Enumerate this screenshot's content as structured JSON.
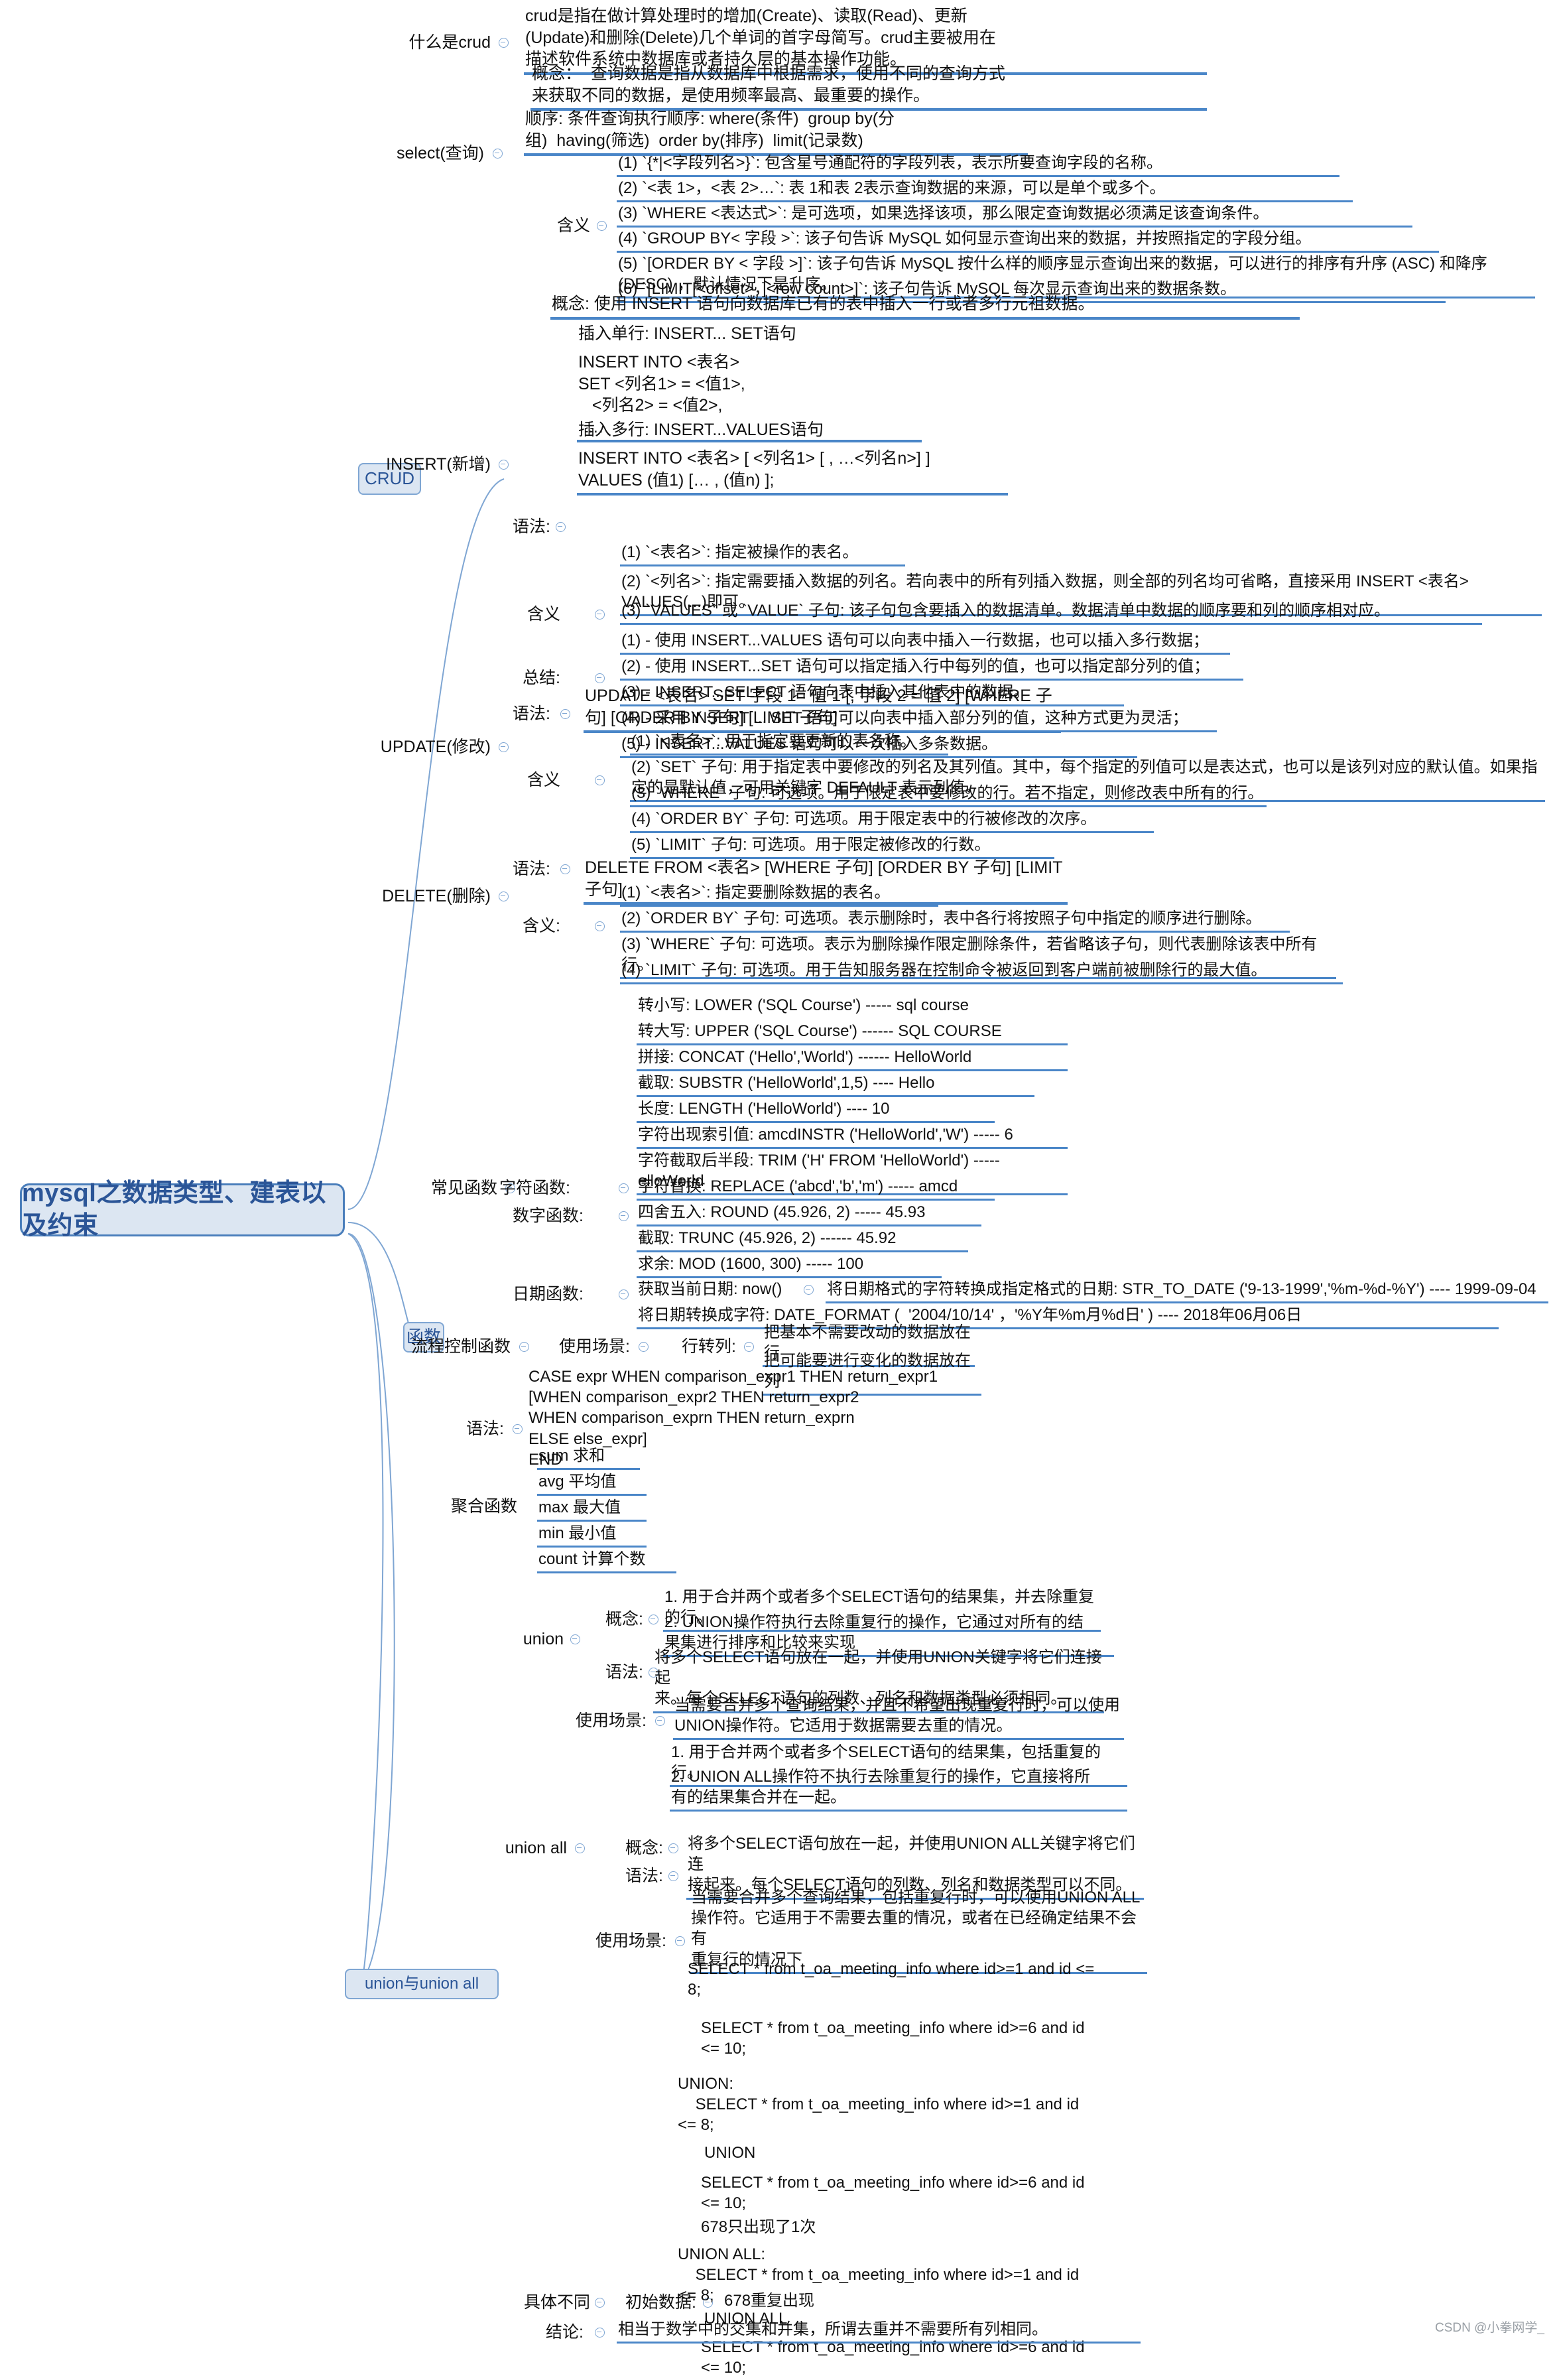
{
  "meta": {
    "root_title": "mysql之数据类型、建表以及约束",
    "watermark": "CSDN @小拳网学_",
    "accent": "#4a86c8",
    "root_fill": "#dce6f2",
    "root_border": "#4a7ebb",
    "root_text": "#2b5597"
  },
  "branches": {
    "crud": "CRUD",
    "func": "函数",
    "union": "union与union all"
  },
  "crud": {
    "what_is_crud": {
      "label": "什么是crud",
      "text": "crud是指在做计算处理时的增加(Create)、读取(Read)、更新\n(Update)和删除(Delete)几个单词的首字母简写。crud主要被用在\n描述软件系统中数据库或者持久层的基本操作功能。"
    },
    "select": {
      "label": "select(查询)",
      "concept": "概念：  查询数据是指从数据库中根据需求，使用不同的查询方式\n来获取不同的数据，是使用频率最高、最重要的操作。",
      "order": "顺序: 条件查询执行顺序: where(条件)  group by(分\n组)  having(筛选)  order by(排序)  limit(记录数)",
      "meaning_label": "含义",
      "meanings": [
        "(1) `{*|<字段列名>}`: 包含星号通配符的字段列表，表示所要查询字段的名称。",
        "(2) `<表 1>，<表 2>…`: 表 1和表 2表示查询数据的来源，可以是单个或多个。",
        "(3) `WHERE <表达式>`: 是可选项，如果选择该项，那么限定查询数据必须满足该查询条件。",
        "(4) `GROUP BY< 字段 >`: 该子句告诉 MySQL 如何显示查询出来的数据，并按照指定的字段分组。",
        "(5) `[ORDER BY < 字段 >]`: 该子句告诉 MySQL 按什么样的顺序显示查询出来的数据，可以进行的排序有升序 (ASC) 和降序 (DESC) ，默认情况下是升序。",
        "(6) `[LIMIT[<offset>，]<row count>]`: 该子句告诉 MySQL 每次显示查询出来的数据条数。"
      ]
    },
    "insert": {
      "label": "INSERT(新增)",
      "concept": "概念: 使用 INSERT 语句向数据库已有的表中插入一行或者多行元祖数据。",
      "syntax_label": "语法:",
      "syntax_single_title": "插入单行: INSERT... SET语句",
      "syntax_single_code": "INSERT INTO <表名>\nSET <列名1> = <值1>,\n   <列名2> = <值2>,\n  …",
      "syntax_multi_title": "插入多行: INSERT...VALUES语句",
      "syntax_multi_code": "INSERT INTO <表名> [ <列名1> [ , …<列名n>] ]\nVALUES (值1) [… , (值n) ];",
      "meaning_label": "含义",
      "meanings": [
        "(1) `<表名>`: 指定被操作的表名。",
        "(2) `<列名>`: 指定需要插入数据的列名。若向表中的所有列插入数据，则全部的列名均可省略，直接采用 INSERT <表名> VALUES(...)即可。",
        "(3) `VALUES` 或 `VALUE` 子句: 该子句包含要插入的数据清单。数据清单中数据的顺序要和列的顺序相对应。"
      ],
      "summary_label": "总结:",
      "summaries": [
        "(1) - 使用 INSERT...VALUES 语句可以向表中插入一行数据，也可以插入多行数据；",
        "(2) - 使用 INSERT...SET 语句可以指定插入行中每列的值，也可以指定部分列的值；",
        "(3) - INSERT...SELECT 语句向表中插入其他表中的数据。",
        "(4) - 采用 INSERT ... SET 语句可以向表中插入部分列的值，这种方式更为灵活；",
        "(5) - INSERT...VALUES 语句可以一次插入多条数据。"
      ]
    },
    "update": {
      "label": "UPDATE(修改)",
      "syntax_label": "语法:",
      "syntax": "UPDATE <表名> SET 字段 1= 值 1 [, 字段 2 = 值 2] [WHERE 子\n句] [ORDER BY 子句] [LIMIT 子句]",
      "meaning_label": "含义",
      "meanings": [
        "(1) `<表名>`: 用于指定要更新的表名称。",
        "(2) `SET` 子句: 用于指定表中要修改的列名及其列值。其中，每个指定的列值可以是表达式，也可以是该列对应的默认值。如果指定的是默认值，可用关键字 DEFAULT 表示列值。",
        "(3) `WHERE` 子句: 可选项。用于限定表中要修改的行。若不指定，则修改表中所有的行。",
        "(4) `ORDER BY` 子句: 可选项。用于限定表中的行被修改的次序。",
        "(5) `LIMIT` 子句: 可选项。用于限定被修改的行数。"
      ]
    },
    "delete": {
      "label": "DELETE(删除)",
      "syntax_label": "语法:",
      "syntax": "DELETE FROM <表名> [WHERE 子句] [ORDER BY 子句] [LIMIT 子句]",
      "meaning_label": "含义:",
      "meanings": [
        "(1) `<表名>`: 指定要删除数据的表名。",
        "(2) `ORDER BY` 子句: 可选项。表示删除时，表中各行将按照子句中指定的顺序进行删除。",
        "(3) `WHERE` 子句: 可选项。表示为删除操作限定删除条件，若省略该子句，则代表删除该表中所有行。",
        "(4) `LIMIT` 子句: 可选项。用于告知服务器在控制命令被返回到客户端前被删除行的最大值。"
      ]
    }
  },
  "func": {
    "common_label": "常见函数",
    "char_label": "字符函数:",
    "char_items": [
      "转小写: LOWER ('SQL Course') ----- sql course",
      "转大写: UPPER ('SQL Course') ------ SQL COURSE",
      "拼接: CONCAT ('Hello','World') ------ HelloWorld",
      "截取: SUBSTR ('HelloWorld',1,5) ---- Hello",
      "长度: LENGTH ('HelloWorld') ---- 10",
      "字符出现索引值: amcdINSTR ('HelloWorld','W') ----- 6",
      "字符截取后半段: TRIM ('H' FROM 'HelloWorld') ----- elloWorld",
      "字符替换: REPLACE ('abcd','b','m') ----- amcd"
    ],
    "num_label": "数字函数:",
    "num_items": [
      "四舍五入: ROUND (45.926, 2) ----- 45.93",
      "截取: TRUNC (45.926, 2) ------ 45.92",
      "求余: MOD (1600, 300) ----- 100"
    ],
    "date_label": "日期函数:",
    "date_now": "获取当前日期: now()",
    "date_items": [
      "将日期格式的字符转换成指定格式的日期: STR_TO_DATE ('9-13-1999','%m-%d-%Y') ---- 1999-09-04",
      "将日期转换成字符: DATE_FORMAT (  '2004/10/14' ，'%Y年%m月%d日' ) ---- 2018年06月06日"
    ],
    "flow_label": "流程控制函数",
    "scene_label": "使用场景:",
    "row2col_label": "行转列:",
    "row2col_items": [
      "把基本不需要改动的数据放在行",
      "把可能要进行变化的数据放在列"
    ],
    "syntax_label": "语法:",
    "syntax": "CASE expr WHEN comparison_expr1 THEN return_expr1\n[WHEN comparison_expr2 THEN return_expr2\nWHEN comparison_exprn THEN return_exprn\nELSE else_expr]\nEND",
    "agg_label": "聚合函数",
    "agg_items": [
      "sum 求和",
      "avg 平均值",
      "max 最大值",
      "min 最小值",
      "count 计算个数"
    ]
  },
  "union": {
    "union_label": "union",
    "union_concept_label": "概念:",
    "union_concepts": [
      "1. 用于合并两个或者多个SELECT语句的结果集，并去除重复的行。",
      "2. UNION操作符执行去除重复行的操作，它通过对所有的结\n果集进行排序和比较来实现"
    ],
    "union_syntax_label": "语法:",
    "union_syntax": "将多个SELECT语句放在一起，并使用UNION关键字将它们连接起\n来。每个SELECT语句的列数、列名和数据类型必须相同。",
    "union_scene_label": "使用场景:",
    "union_scene": "当需要合并多个查询结果，并且不希望出现重复行时，可以使用\nUNION操作符。它适用于数据需要去重的情况。",
    "unionall_label": "union all",
    "unionall_concept_label": "概念:",
    "unionall_concepts": [
      "1. 用于合并两个或者多个SELECT语句的结果集，包括重复的行。",
      "2. UNION ALL操作符不执行去除重复行的操作，它直接将所\n有的结果集合并在一起。"
    ],
    "unionall_syntax_label": "语法:",
    "unionall_syntax": "将多个SELECT语句放在一起，并使用UNION ALL关键字将它们连\n接起来。每个SELECT语句的列数、列名和数据类型可以不同。",
    "unionall_scene_label": "使用场景:",
    "unionall_scene": "当需要合并多个查询结果，包括重复行时，可以使用UNION ALL\n操作符。它适用于不需要去重的情况，或者在已经确定结果不会有\n重复行的情况下",
    "diff_label": "具体不同",
    "init_label": "初始数据:",
    "code_blocks": [
      "SELECT * from t_oa_meeting_info where id>=1 and id <=\n8;",
      "SELECT * from t_oa_meeting_info where id>=6 and id\n<= 10;",
      "UNION:\n    SELECT * from t_oa_meeting_info where id>=1 and id\n<= 8;",
      "UNION",
      "SELECT * from t_oa_meeting_info where id>=6 and id\n<= 10;",
      "678只出现了1次",
      "UNION ALL:\n    SELECT * from t_oa_meeting_info where id>=1 and id\n<= 8;",
      "UNION ALL",
      "SELECT * from t_oa_meeting_info where id>=6 and id\n<= 10;"
    ],
    "init_value": "678重复出现",
    "conclusion_label": "结论:",
    "conclusion": "相当于数学中的交集和并集，所谓去重并不需要所有列相同。"
  }
}
